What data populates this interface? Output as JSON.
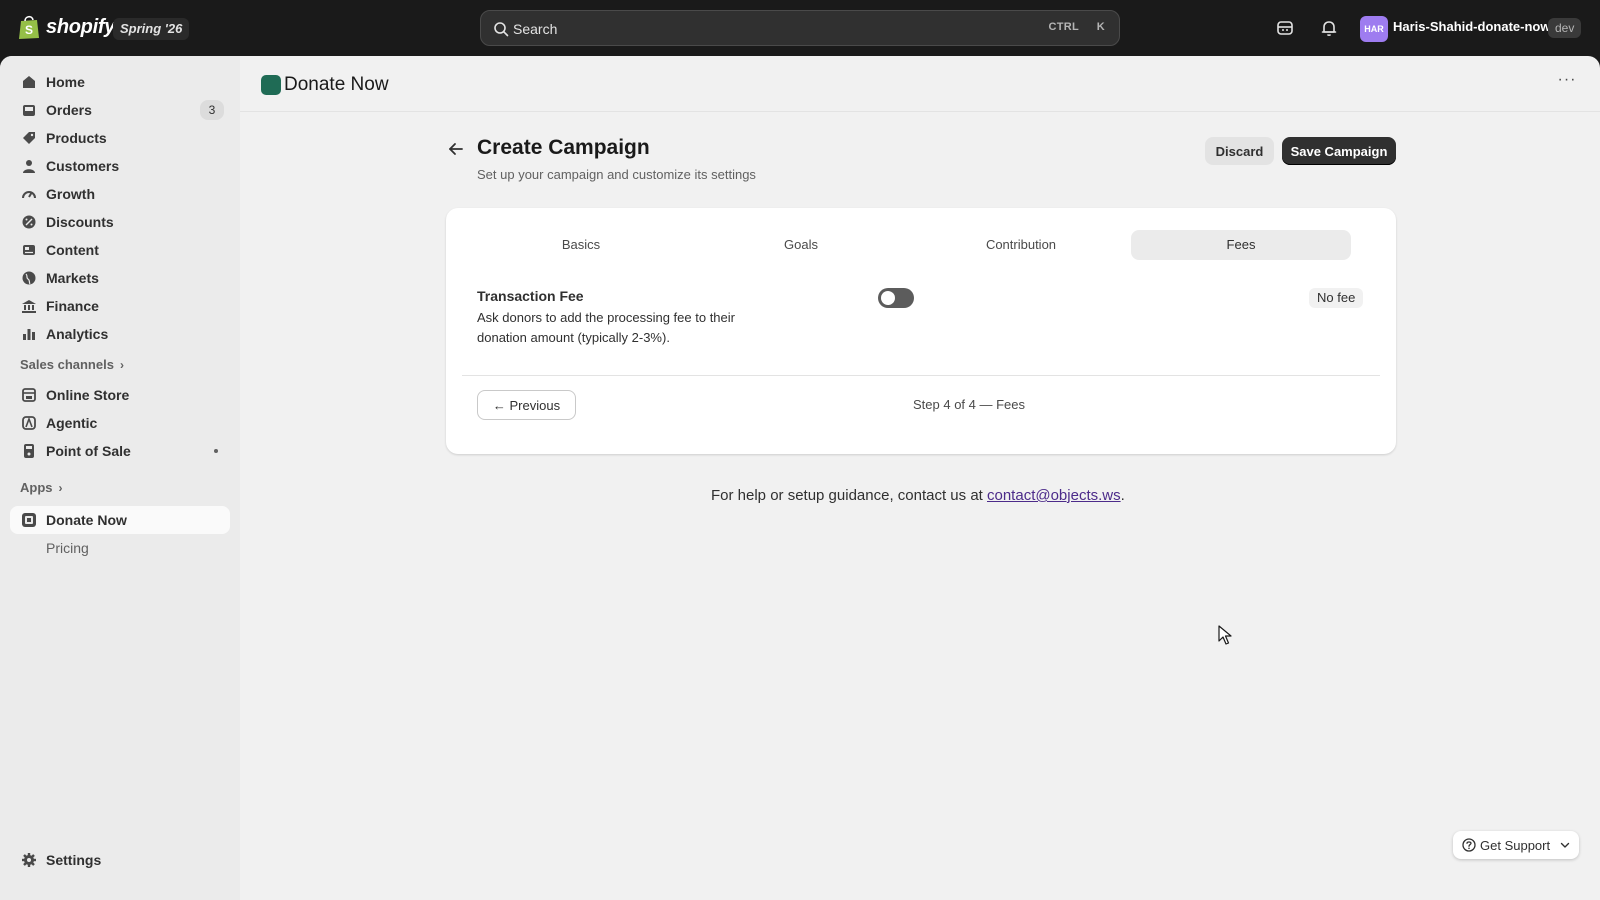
{
  "topbar": {
    "brand": "shopify",
    "edition": "Spring '26",
    "search_placeholder": "Search",
    "shortcut_ctrl": "CTRL",
    "shortcut_key": "K",
    "avatar_initials": "HAR",
    "store_name": "Haris-Shahid-donate-now",
    "env_badge": "dev"
  },
  "sidebar": {
    "items": [
      {
        "label": "Home",
        "icon": "home-icon"
      },
      {
        "label": "Orders",
        "icon": "orders-icon",
        "count": "3"
      },
      {
        "label": "Products",
        "icon": "tag-icon"
      },
      {
        "label": "Customers",
        "icon": "person-icon"
      },
      {
        "label": "Growth",
        "icon": "gauge-icon"
      },
      {
        "label": "Discounts",
        "icon": "discount-icon"
      },
      {
        "label": "Content",
        "icon": "content-icon"
      },
      {
        "label": "Markets",
        "icon": "globe-icon"
      },
      {
        "label": "Finance",
        "icon": "bank-icon"
      },
      {
        "label": "Analytics",
        "icon": "bar-chart-icon"
      }
    ],
    "sales_channels_heading": "Sales channels",
    "channels": [
      {
        "label": "Online Store",
        "icon": "store-icon"
      },
      {
        "label": "Agentic",
        "icon": "agentic-icon"
      },
      {
        "label": "Point of Sale",
        "icon": "pos-icon"
      }
    ],
    "apps_heading": "Apps",
    "apps": [
      {
        "label": "Donate Now",
        "icon": "app-icon"
      },
      {
        "label": "Pricing"
      }
    ],
    "settings_label": "Settings"
  },
  "app": {
    "title": "Donate Now",
    "more": "···"
  },
  "page": {
    "title": "Create Campaign",
    "subtitle": "Set up your campaign and customize its settings",
    "discard_label": "Discard",
    "save_label": "Save Campaign"
  },
  "tabs": [
    "Basics",
    "Goals",
    "Contribution",
    "Fees"
  ],
  "active_tab": "Fees",
  "fees": {
    "title": "Transaction Fee",
    "description": "Ask donors to add the processing fee to their donation amount (typically 2-3%).",
    "toggle_on": false,
    "badge": "No fee"
  },
  "footer": {
    "previous_label": "← Previous",
    "step_text": "Step 4 of 4 — Fees"
  },
  "help": {
    "prefix": "For help or setup guidance, contact us at ",
    "email": "contact@objects.ws",
    "suffix": "."
  },
  "support_label": "Get Support",
  "colors": {
    "topbar": "#1a1a1a",
    "primary_button": "#303030",
    "app_icon": "#1f6b55",
    "avatar": "#9e7cf0",
    "link": "#4c2b8a"
  }
}
